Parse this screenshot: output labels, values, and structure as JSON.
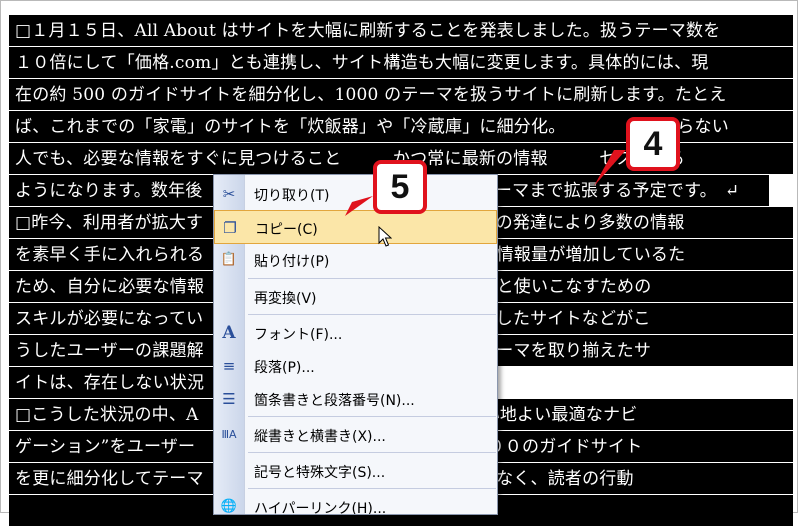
{
  "document": {
    "lines": [
      "□１月１５日、All About はサイトを大幅に刷新することを発表しました。扱うテーマ数を",
      "１０倍にして「価格.com」とも連携し、サイト構造も大幅に変更します。具体的には、現",
      "在の約 500 のガイドサイトを細分化し、1000 のテーマを扱うサイトに刷新します。たとえ",
      "ば、これまでの「家電」のサイトを「炊飯器」や「冷蔵庫」に細分化。　　　　　を知らない",
      "人でも、必要な情報をすぐに見つけること　　　かつ常に最新の情報　　　セスできる",
      "ようになります。数年後　　　　　　　　　　　　　　　０テーマまで拡張する予定です。",
      "□昨今、利用者が拡大す　　　　　　　　　　　　　検索機能の発達により多数の情報",
      "を素早く手に入れられる　　　　　　　　　　　　ビを中心に情報量が増加しているた",
      "ため、自分に必要な情報　　　　　　　　　　　ネットの知識と使いこなすための",
      "スキルが必要になってい　　　　　　　　　　　テーマに特化したサイトなどがこ",
      "うしたユーザーの課題解　　　　　　　　　　　在、多数のテーマを取り揃えたサ",
      "イトは、存在しない状況",
      "□こうした状況の中、A　　　　　　　　　　　“人を介した心地よい最適なナビ",
      "ゲーション”をユーザー　　　　　　　　　　　を改革し、５００のガイドサイト",
      "を更に細分化してテーマ　　　　　　　　　　報提供だけではなく、読者の行動",
      "　"
    ],
    "return_mark": "↵"
  },
  "context_menu": {
    "items": [
      {
        "label": "切り取り(T)",
        "icon": "scissors-icon",
        "glyph": "✂"
      },
      {
        "label": "コピー(C)",
        "icon": "copy-icon",
        "glyph": "❐"
      },
      {
        "label": "貼り付け(P)",
        "icon": "paste-icon",
        "glyph": "📋"
      },
      {
        "label": "再変換(V)",
        "icon": "",
        "glyph": ""
      },
      {
        "label": "フォント(F)...",
        "icon": "font-icon",
        "glyph": "A"
      },
      {
        "label": "段落(P)...",
        "icon": "paragraph-icon",
        "glyph": "≡"
      },
      {
        "label": "箇条書きと段落番号(N)...",
        "icon": "bullets-icon",
        "glyph": "☰"
      },
      {
        "label": "縦書きと横書き(X)...",
        "icon": "vertical-text-icon",
        "glyph": "ⅢA"
      },
      {
        "label": "記号と特殊文字(S)...",
        "icon": "",
        "glyph": ""
      },
      {
        "label": "ハイパーリンク(H)...",
        "icon": "hyperlink-icon",
        "glyph": "🌐"
      }
    ],
    "highlighted_index": 1
  },
  "callouts": {
    "step4": "4",
    "step5": "5"
  },
  "colors": {
    "selection": "#000000",
    "callout_border": "#e0121d",
    "menu_highlight": "#fbe6a8"
  }
}
